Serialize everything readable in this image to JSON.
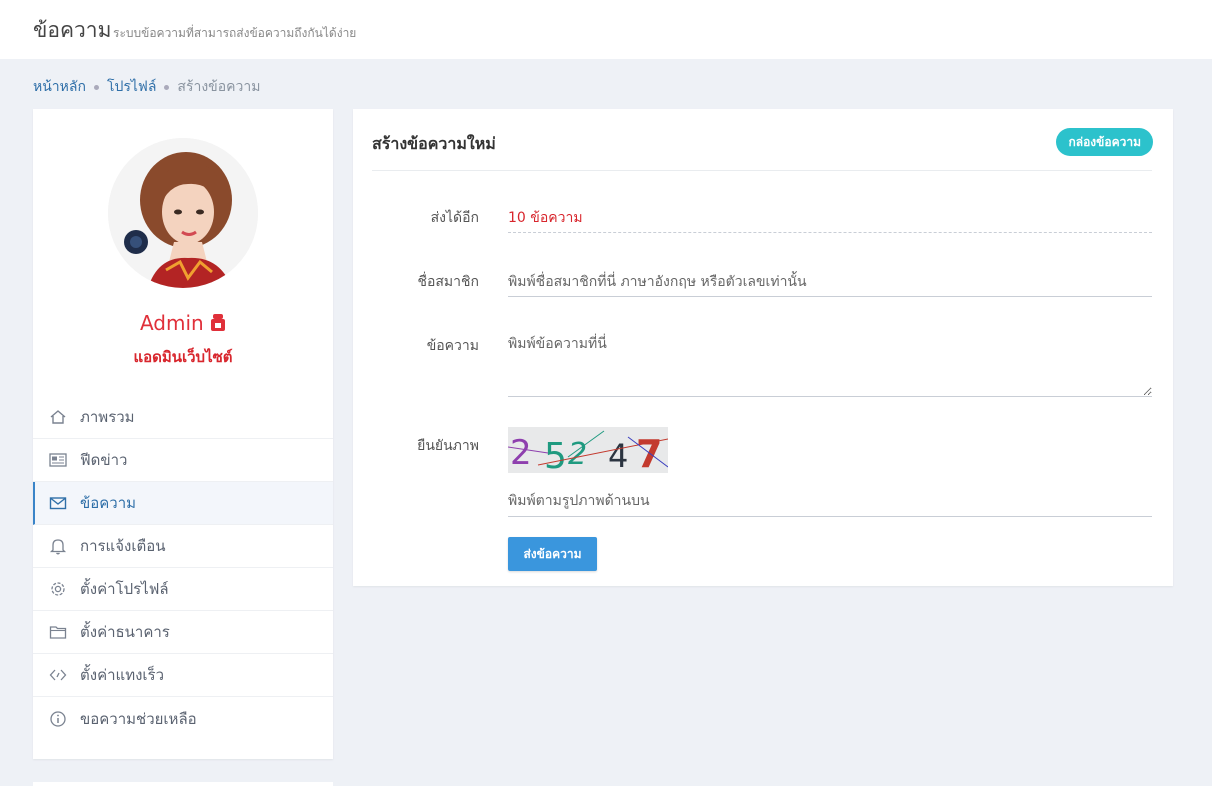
{
  "header": {
    "title": "ข้อความ",
    "subtitle": "ระบบข้อความที่สามารถส่งข้อความถึงกันได้ง่าย"
  },
  "breadcrumb": {
    "items": [
      "หน้าหลัก",
      "โปรไฟล์"
    ],
    "current": "สร้างข้อความ"
  },
  "profile": {
    "name": "Admin",
    "role": "แอดมินเว็บไซต์",
    "accent_color": "#e0303a"
  },
  "sidebar": {
    "items": [
      {
        "label": "ภาพรวม",
        "icon": "home-icon"
      },
      {
        "label": "ฟีดข่าว",
        "icon": "newspaper-icon"
      },
      {
        "label": "ข้อความ",
        "icon": "mail-icon",
        "active": true
      },
      {
        "label": "การแจ้งเตือน",
        "icon": "bell-icon"
      },
      {
        "label": "ตั้งค่าโปรไฟล์",
        "icon": "gear-icon"
      },
      {
        "label": "ตั้งค่าธนาคาร",
        "icon": "folder-icon"
      },
      {
        "label": "ตั้งค่าแทงเร็ว",
        "icon": "code-icon"
      },
      {
        "label": "ขอความช่วยเหลือ",
        "icon": "info-icon"
      }
    ]
  },
  "compose": {
    "title": "สร้างข้อความใหม่",
    "inbox_button": "กล่องข้อความ",
    "remaining_label": "ส่งได้อีก",
    "remaining_value": "10 ข้อความ",
    "member_label": "ชื่อสมาชิก",
    "member_placeholder": "พิมพ์ชื่อสมาชิกที่นี่ ภาษาอังกฤษ หรือตัวเลขเท่านั้น",
    "message_label": "ข้อความ",
    "message_placeholder": "พิมพ์ข้อความที่นี่",
    "captcha_label": "ยืนยันภาพ",
    "captcha_digits": [
      "2",
      "5",
      "2",
      "4",
      "7"
    ],
    "captcha_placeholder": "พิมพ์ตามรูปภาพด้านบน",
    "submit_label": "ส่งข้อความ"
  },
  "colors": {
    "accent": "#3a96dd",
    "inbox_button": "#2cc2cc",
    "link": "#2f6fa8",
    "danger": "#d8262d"
  }
}
